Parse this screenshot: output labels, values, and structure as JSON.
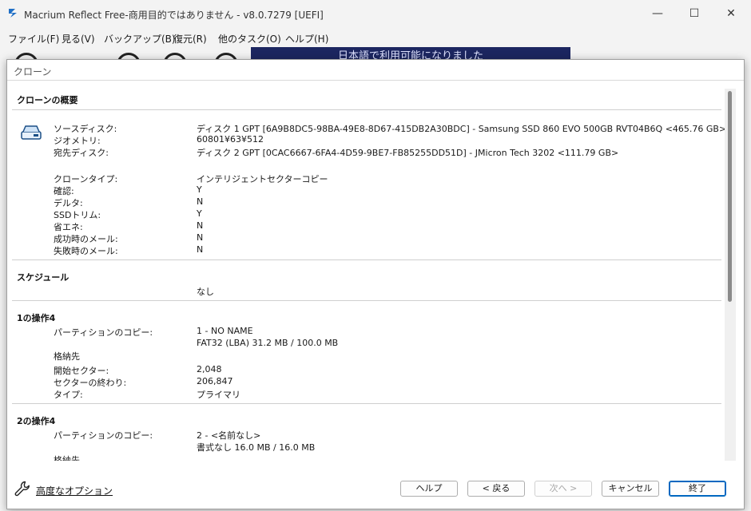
{
  "window": {
    "title": "Macrium Reflect Free-商用目的ではありません - v8.0.7279  [UEFI]",
    "minimize": "—",
    "maximize": "☐",
    "close": "✕"
  },
  "menu": [
    "ファイル(F)",
    "見る(V)",
    "バックアップ(B)",
    "復元(R)",
    "他のタスク(O)",
    "ヘルプ(H)"
  ],
  "banner": "日本語で利用可能になりました",
  "dialog": {
    "title": "クローン",
    "overview": {
      "heading": "クローンの概要",
      "rows": [
        {
          "label": "ソースディスク:",
          "value": "ディスク 1 GPT [6A9B8DC5-98BA-49E8-8D67-415DB2A30BDC] - Samsung SSD 860 EVO 500GB RVT04B6Q  <465.76 GB>"
        },
        {
          "label": "ジオメトリ:",
          "value": "60801¥63¥512"
        },
        {
          "label": "宛先ディスク:",
          "value": "ディスク 2 GPT [0CAC6667-6FA4-4D59-9BE7-FB85255DD51D] - JMicron  Tech          3202  <111.79 GB>"
        }
      ],
      "options": [
        {
          "label": "クローンタイプ:",
          "value": "インテリジェントセクターコピー"
        },
        {
          "label": "確認:",
          "value": "Y"
        },
        {
          "label": "デルタ:",
          "value": "N"
        },
        {
          "label": "SSDトリム:",
          "value": "Y"
        },
        {
          "label": "省エネ:",
          "value": "N"
        },
        {
          "label": "成功時のメール:",
          "value": "N"
        },
        {
          "label": "失敗時のメール:",
          "value": "N"
        }
      ]
    },
    "schedule": {
      "heading": "スケジュール",
      "value": "なし"
    },
    "op1": {
      "heading": "1の操作4",
      "copy_label": "パーティションのコピー:",
      "copy_value": "1 - NO NAME",
      "copy_detail": "FAT32 (LBA) 31.2 MB / 100.0 MB",
      "dest_label": "格納先",
      "rows": [
        {
          "label": "開始セクター:",
          "value": "2,048"
        },
        {
          "label": "セクターの終わり:",
          "value": "206,847"
        },
        {
          "label": "タイプ:",
          "value": "プライマリ"
        }
      ]
    },
    "op2": {
      "heading": "2の操作4",
      "copy_label": "パーティションのコピー:",
      "copy_value": "2 - <名前なし>",
      "copy_detail": "書式なし 16.0 MB / 16.0 MB",
      "dest_label": "格納先"
    },
    "footer": {
      "advanced": "高度なオプション",
      "help": "ヘルプ",
      "back": "< 戻る",
      "next": "次へ >",
      "cancel": "キャンセル",
      "finish": "終了"
    }
  }
}
